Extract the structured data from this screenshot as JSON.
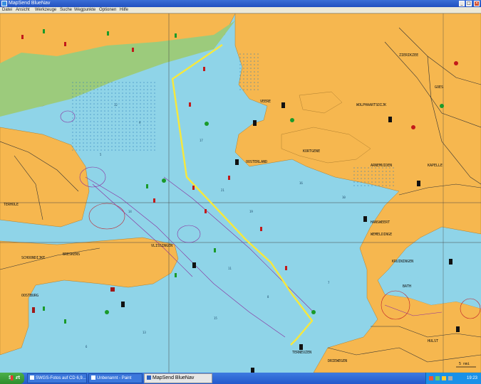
{
  "window": {
    "title": "MapSend BlueNav"
  },
  "menu": {
    "items": [
      "Datei",
      "Ansicht",
      "Werkzeuge",
      "Suche",
      "Wegpunkte",
      "Optionen",
      "Hilfe"
    ]
  },
  "map": {
    "scale_label": "5 nmi",
    "place_labels": [
      "OOSTERLAND",
      "KORTGENE",
      "WOLPHAARTSDIJK",
      "VEERE",
      "VLISSINGEN",
      "BRESKENS",
      "OOSTBURG",
      "TERNEUZEN",
      "HANSWEERT",
      "WEMELDINGE",
      "KRUININGEN",
      "BATH",
      "HULST",
      "ZIERIKZEE",
      "GOES",
      "KAPELLE",
      "SCHOONDIJKE",
      "TERHOLE",
      "ARNEMUIDEN",
      "DRIEWEGEN"
    ]
  },
  "taskbar": {
    "start_label": "Start",
    "tasks": [
      "SWGS-Fotos auf CD 6,9...",
      "Unbenannt - Paint",
      "MapSend BlueNav"
    ],
    "clock": "19:23"
  }
}
